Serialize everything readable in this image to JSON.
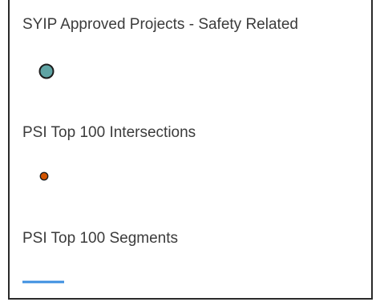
{
  "legend": {
    "items": [
      {
        "label": "SYIP Approved Projects - Safety Related",
        "symbol": "circle",
        "fill_color": "#5fa4a4",
        "outline_color": "#1c1c1c"
      },
      {
        "label": "PSI Top 100 Intersections",
        "symbol": "circle",
        "fill_color": "#d35400",
        "outline_color": "#1c1c1c"
      },
      {
        "label": "PSI Top 100 Segments",
        "symbol": "line",
        "line_color": "#3d8fe0"
      }
    ]
  }
}
